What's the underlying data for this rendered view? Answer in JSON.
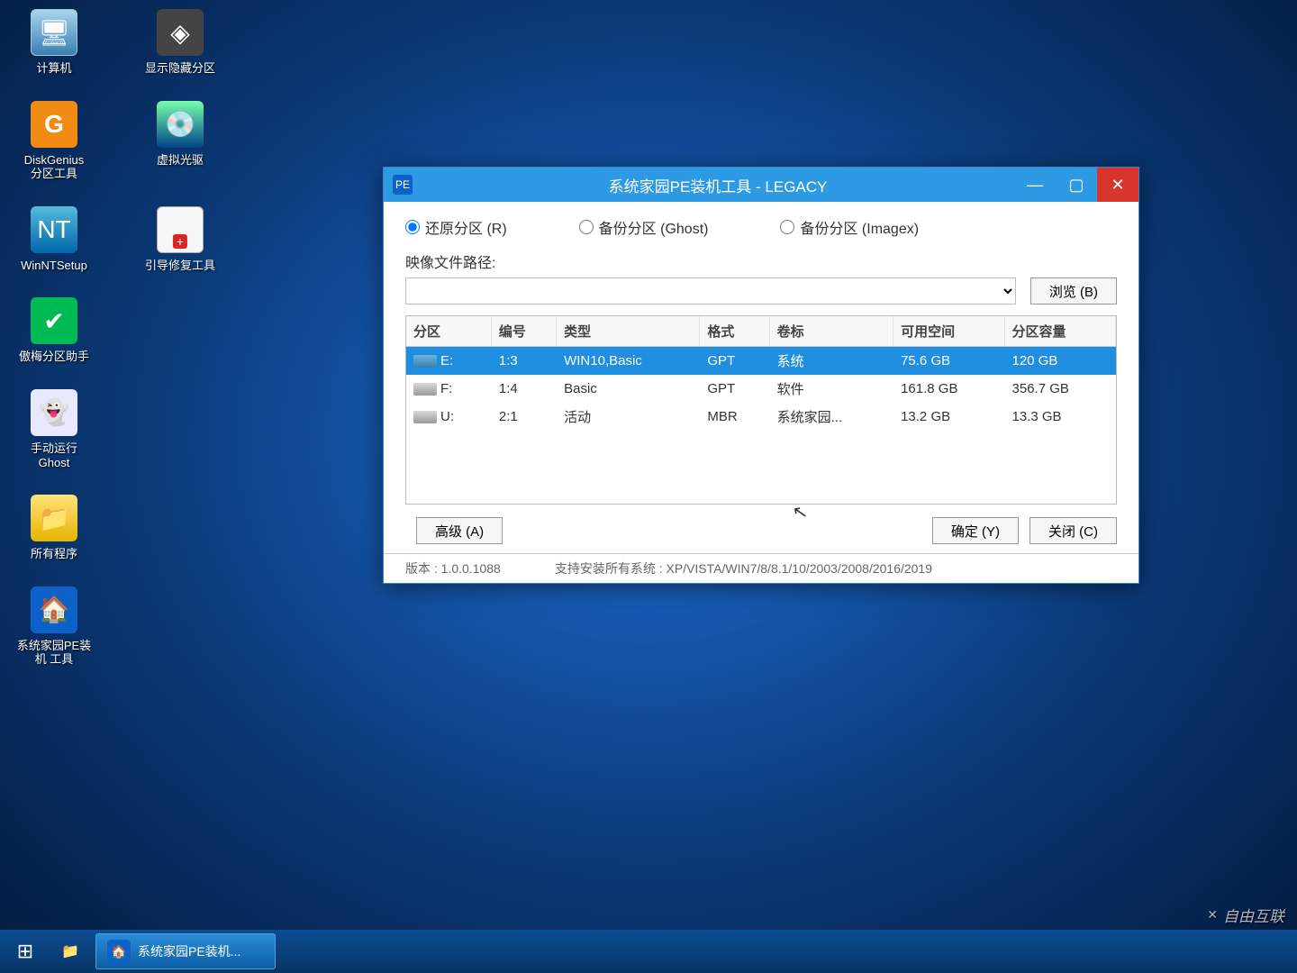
{
  "desktop": {
    "icons": [
      {
        "label": "计算机"
      },
      {
        "label": "显示隐藏分区"
      },
      {
        "label": "DiskGenius\n分区工具"
      },
      {
        "label": "虚拟光驱"
      },
      {
        "label": "WinNTSetup"
      },
      {
        "label": "引导修复工具"
      },
      {
        "label": "傲梅分区助手"
      },
      {
        "label": "手动运行\nGhost"
      },
      {
        "label": "所有程序"
      },
      {
        "label": "系统家园PE装\n机 工具"
      }
    ]
  },
  "window": {
    "title": "系统家园PE装机工具 - LEGACY",
    "radios": {
      "restore": "还原分区 (R)",
      "backup_ghost": "备份分区 (Ghost)",
      "backup_imagex": "备份分区 (Imagex)"
    },
    "path_label": "映像文件路径:",
    "path_value": "",
    "browse": "浏览 (B)",
    "table": {
      "headers": [
        "分区",
        "编号",
        "类型",
        "格式",
        "卷标",
        "可用空间",
        "分区容量"
      ],
      "rows": [
        {
          "drive": "E:",
          "num": "1:3",
          "type": "WIN10,Basic",
          "fmt": "GPT",
          "label": "系统",
          "free": "75.6 GB",
          "cap": "120 GB",
          "selected": true
        },
        {
          "drive": "F:",
          "num": "1:4",
          "type": "Basic",
          "fmt": "GPT",
          "label": "软件",
          "free": "161.8 GB",
          "cap": "356.7 GB",
          "selected": false
        },
        {
          "drive": "U:",
          "num": "2:1",
          "type": "活动",
          "fmt": "MBR",
          "label": "系统家园...",
          "free": "13.2 GB",
          "cap": "13.3 GB",
          "selected": false
        }
      ]
    },
    "buttons": {
      "advanced": "高级 (A)",
      "ok": "确定 (Y)",
      "close": "关闭 (C)"
    },
    "status": {
      "version": "版本 : 1.0.0.1088",
      "support": "支持安装所有系统 : XP/VISTA/WIN7/8/8.1/10/2003/2008/2016/2019"
    }
  },
  "taskbar": {
    "item": "系统家园PE装机..."
  },
  "watermark": "自由互联"
}
